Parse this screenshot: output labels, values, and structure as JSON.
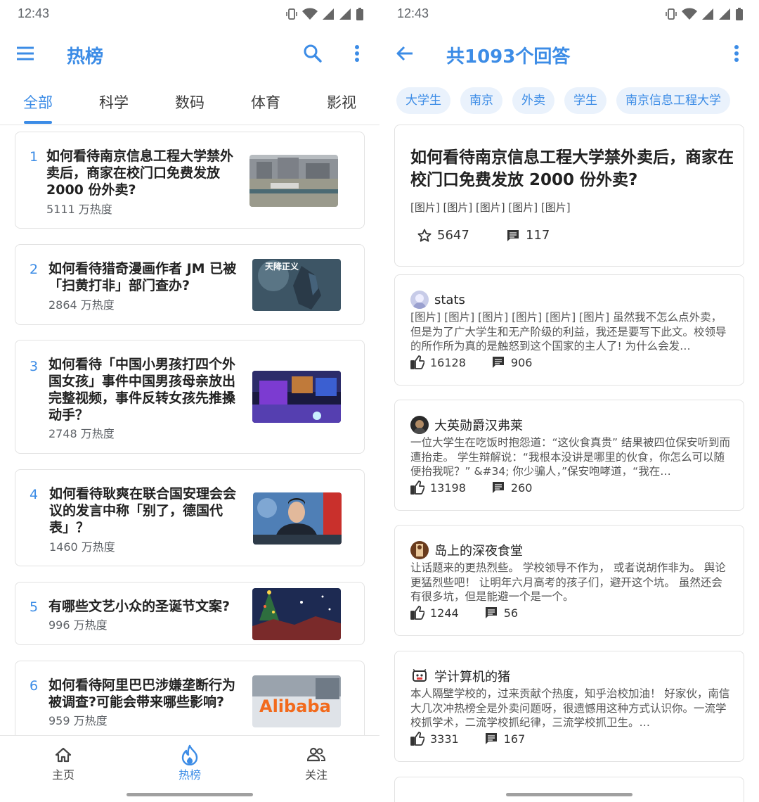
{
  "left": {
    "status": {
      "time": "12:43"
    },
    "appbar": {
      "title": "热榜"
    },
    "tabs": [
      "全部",
      "科学",
      "数码",
      "体育",
      "影视"
    ],
    "items": [
      {
        "rank": "1",
        "title": "如何看待南京信息工程大学禁外卖后，商家在校门口免费发放 2000 份外卖?",
        "heat": "5111 万热度"
      },
      {
        "rank": "2",
        "title": "如何看待猎奇漫画作者 JM 已被「扫黄打非」部门查办?",
        "heat": "2864 万热度",
        "thumb_text": "天降正义"
      },
      {
        "rank": "3",
        "title": "如何看待「中国小男孩打四个外国女孩」事件中国男孩母亲放出完整视频，事件反转女孩先推搡动手？",
        "heat": "2748 万热度"
      },
      {
        "rank": "4",
        "title": "如何看待耿爽在联合国安理会会议的发言中称「别了，德国代表」？",
        "heat": "1460 万热度"
      },
      {
        "rank": "5",
        "title": "有哪些文艺小众的圣诞节文案?",
        "heat": "996 万热度"
      },
      {
        "rank": "6",
        "title": "如何看待阿里巴巴涉嫌垄断行为被调查?可能会带来哪些影响?",
        "heat": "959 万热度",
        "thumb_text": "Alibaba"
      }
    ],
    "nav": {
      "home": "主页",
      "hot": "热榜",
      "follow": "关注"
    }
  },
  "right": {
    "status": {
      "time": "12:43"
    },
    "appbar": {
      "title": "共1093个回答"
    },
    "chips": [
      "大学生",
      "南京",
      "外卖",
      "学生",
      "南京信息工程大学"
    ],
    "question": {
      "title": "如何看待南京信息工程大学禁外卖后，商家在校门口免费发放 2000 份外卖?",
      "images": "[图片] [图片] [图片] [图片] [图片]",
      "stars": "5647",
      "comments": "117"
    },
    "answers": [
      {
        "author": "stats",
        "excerpt": "[图片] [图片] [图片] [图片] [图片] [图片] 虽然我不怎么点外卖，但是为了广大学生和无产阶级的利益，我还是要写下此文。校领导的所作所为真的是触怒到这个国家的主人了! 为什么会发…",
        "likes": "16128",
        "comments": "906"
      },
      {
        "author": "大英勋爵汉弗莱",
        "excerpt": "一位大学生在吃饭时抱怨道：“这伙食真贵” 结果被四位保安听到而遭抬走。 学生辩解说：“我根本没讲是哪里的伙食，你怎么可以随便抬我呢？” &#34; 你少骗人，”保安咆哮道，“我在…",
        "likes": "13198",
        "comments": "260"
      },
      {
        "author": "岛上的深夜食堂",
        "excerpt": "让话题来的更热烈些。 学校领导不作为， 或者说胡作非为。 舆论更猛烈些吧！ 让明年六月高考的孩子们，避开这个坑。 虽然还会有很多坑，但是能避一个是一个。",
        "likes": "1244",
        "comments": "56"
      },
      {
        "author": "学计算机的猪",
        "excerpt": "本人隔壁学校的，过来贡献个热度，知乎治校加油！ 好家伙，南信大几次冲热榜全是外卖问题呀，很遗憾用这种方式认识你。一流学校抓学术，二流学校抓纪律，三流学校抓卫生。…",
        "likes": "3331",
        "comments": "167"
      }
    ]
  },
  "colors": {
    "accent": "#3c8ce6",
    "chip_bg": "#eaf2fc"
  }
}
